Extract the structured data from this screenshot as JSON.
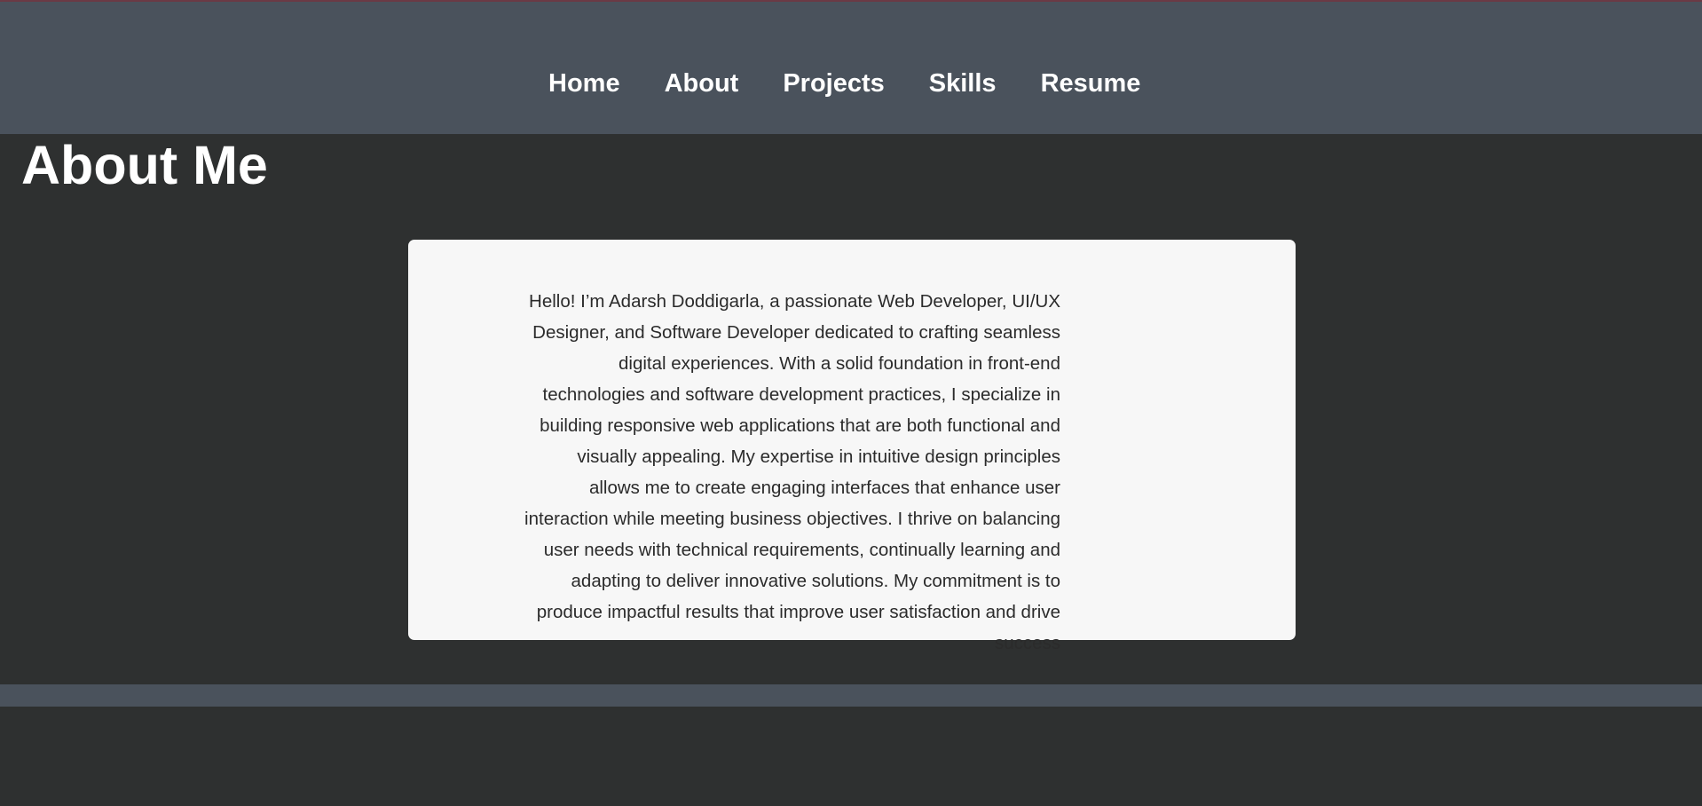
{
  "nav": {
    "items": [
      {
        "label": "Home"
      },
      {
        "label": "About"
      },
      {
        "label": "Projects"
      },
      {
        "label": "Skills"
      },
      {
        "label": "Resume"
      }
    ]
  },
  "about": {
    "title": "About Me",
    "body": "Hello! I’m Adarsh Doddigarla, a passionate Web Developer, UI/UX Designer, and Software Developer dedicated to crafting seamless digital experiences. With a solid foundation in front-end technologies and software development practices, I specialize in building responsive web applications that are both functional and visually appealing. My expertise in intuitive design principles allows me to create engaging interfaces that enhance user interaction while meeting business objectives. I thrive on balancing user needs with technical requirements, continually learning and adapting to deliver innovative solutions. My commitment is to produce impactful results that improve user satisfaction and drive success"
  },
  "colors": {
    "background": "#2e3030",
    "navbar": "#4a525c",
    "card": "#f7f7f7",
    "accent_line": "#6b3a45"
  }
}
